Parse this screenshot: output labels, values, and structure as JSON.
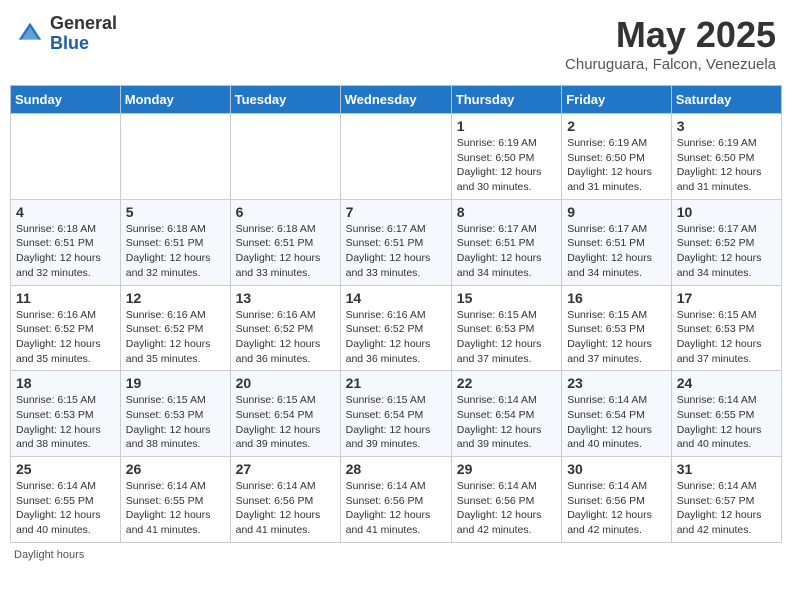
{
  "header": {
    "logo_general": "General",
    "logo_blue": "Blue",
    "month_title": "May 2025",
    "location": "Churuguara, Falcon, Venezuela"
  },
  "weekdays": [
    "Sunday",
    "Monday",
    "Tuesday",
    "Wednesday",
    "Thursday",
    "Friday",
    "Saturday"
  ],
  "weeks": [
    [
      {
        "day": "",
        "info": ""
      },
      {
        "day": "",
        "info": ""
      },
      {
        "day": "",
        "info": ""
      },
      {
        "day": "",
        "info": ""
      },
      {
        "day": "1",
        "info": "Sunrise: 6:19 AM\nSunset: 6:50 PM\nDaylight: 12 hours\nand 30 minutes."
      },
      {
        "day": "2",
        "info": "Sunrise: 6:19 AM\nSunset: 6:50 PM\nDaylight: 12 hours\nand 31 minutes."
      },
      {
        "day": "3",
        "info": "Sunrise: 6:19 AM\nSunset: 6:50 PM\nDaylight: 12 hours\nand 31 minutes."
      }
    ],
    [
      {
        "day": "4",
        "info": "Sunrise: 6:18 AM\nSunset: 6:51 PM\nDaylight: 12 hours\nand 32 minutes."
      },
      {
        "day": "5",
        "info": "Sunrise: 6:18 AM\nSunset: 6:51 PM\nDaylight: 12 hours\nand 32 minutes."
      },
      {
        "day": "6",
        "info": "Sunrise: 6:18 AM\nSunset: 6:51 PM\nDaylight: 12 hours\nand 33 minutes."
      },
      {
        "day": "7",
        "info": "Sunrise: 6:17 AM\nSunset: 6:51 PM\nDaylight: 12 hours\nand 33 minutes."
      },
      {
        "day": "8",
        "info": "Sunrise: 6:17 AM\nSunset: 6:51 PM\nDaylight: 12 hours\nand 34 minutes."
      },
      {
        "day": "9",
        "info": "Sunrise: 6:17 AM\nSunset: 6:51 PM\nDaylight: 12 hours\nand 34 minutes."
      },
      {
        "day": "10",
        "info": "Sunrise: 6:17 AM\nSunset: 6:52 PM\nDaylight: 12 hours\nand 34 minutes."
      }
    ],
    [
      {
        "day": "11",
        "info": "Sunrise: 6:16 AM\nSunset: 6:52 PM\nDaylight: 12 hours\nand 35 minutes."
      },
      {
        "day": "12",
        "info": "Sunrise: 6:16 AM\nSunset: 6:52 PM\nDaylight: 12 hours\nand 35 minutes."
      },
      {
        "day": "13",
        "info": "Sunrise: 6:16 AM\nSunset: 6:52 PM\nDaylight: 12 hours\nand 36 minutes."
      },
      {
        "day": "14",
        "info": "Sunrise: 6:16 AM\nSunset: 6:52 PM\nDaylight: 12 hours\nand 36 minutes."
      },
      {
        "day": "15",
        "info": "Sunrise: 6:15 AM\nSunset: 6:53 PM\nDaylight: 12 hours\nand 37 minutes."
      },
      {
        "day": "16",
        "info": "Sunrise: 6:15 AM\nSunset: 6:53 PM\nDaylight: 12 hours\nand 37 minutes."
      },
      {
        "day": "17",
        "info": "Sunrise: 6:15 AM\nSunset: 6:53 PM\nDaylight: 12 hours\nand 37 minutes."
      }
    ],
    [
      {
        "day": "18",
        "info": "Sunrise: 6:15 AM\nSunset: 6:53 PM\nDaylight: 12 hours\nand 38 minutes."
      },
      {
        "day": "19",
        "info": "Sunrise: 6:15 AM\nSunset: 6:53 PM\nDaylight: 12 hours\nand 38 minutes."
      },
      {
        "day": "20",
        "info": "Sunrise: 6:15 AM\nSunset: 6:54 PM\nDaylight: 12 hours\nand 39 minutes."
      },
      {
        "day": "21",
        "info": "Sunrise: 6:15 AM\nSunset: 6:54 PM\nDaylight: 12 hours\nand 39 minutes."
      },
      {
        "day": "22",
        "info": "Sunrise: 6:14 AM\nSunset: 6:54 PM\nDaylight: 12 hours\nand 39 minutes."
      },
      {
        "day": "23",
        "info": "Sunrise: 6:14 AM\nSunset: 6:54 PM\nDaylight: 12 hours\nand 40 minutes."
      },
      {
        "day": "24",
        "info": "Sunrise: 6:14 AM\nSunset: 6:55 PM\nDaylight: 12 hours\nand 40 minutes."
      }
    ],
    [
      {
        "day": "25",
        "info": "Sunrise: 6:14 AM\nSunset: 6:55 PM\nDaylight: 12 hours\nand 40 minutes."
      },
      {
        "day": "26",
        "info": "Sunrise: 6:14 AM\nSunset: 6:55 PM\nDaylight: 12 hours\nand 41 minutes."
      },
      {
        "day": "27",
        "info": "Sunrise: 6:14 AM\nSunset: 6:56 PM\nDaylight: 12 hours\nand 41 minutes."
      },
      {
        "day": "28",
        "info": "Sunrise: 6:14 AM\nSunset: 6:56 PM\nDaylight: 12 hours\nand 41 minutes."
      },
      {
        "day": "29",
        "info": "Sunrise: 6:14 AM\nSunset: 6:56 PM\nDaylight: 12 hours\nand 42 minutes."
      },
      {
        "day": "30",
        "info": "Sunrise: 6:14 AM\nSunset: 6:56 PM\nDaylight: 12 hours\nand 42 minutes."
      },
      {
        "day": "31",
        "info": "Sunrise: 6:14 AM\nSunset: 6:57 PM\nDaylight: 12 hours\nand 42 minutes."
      }
    ]
  ],
  "footer": {
    "note": "Daylight hours"
  }
}
